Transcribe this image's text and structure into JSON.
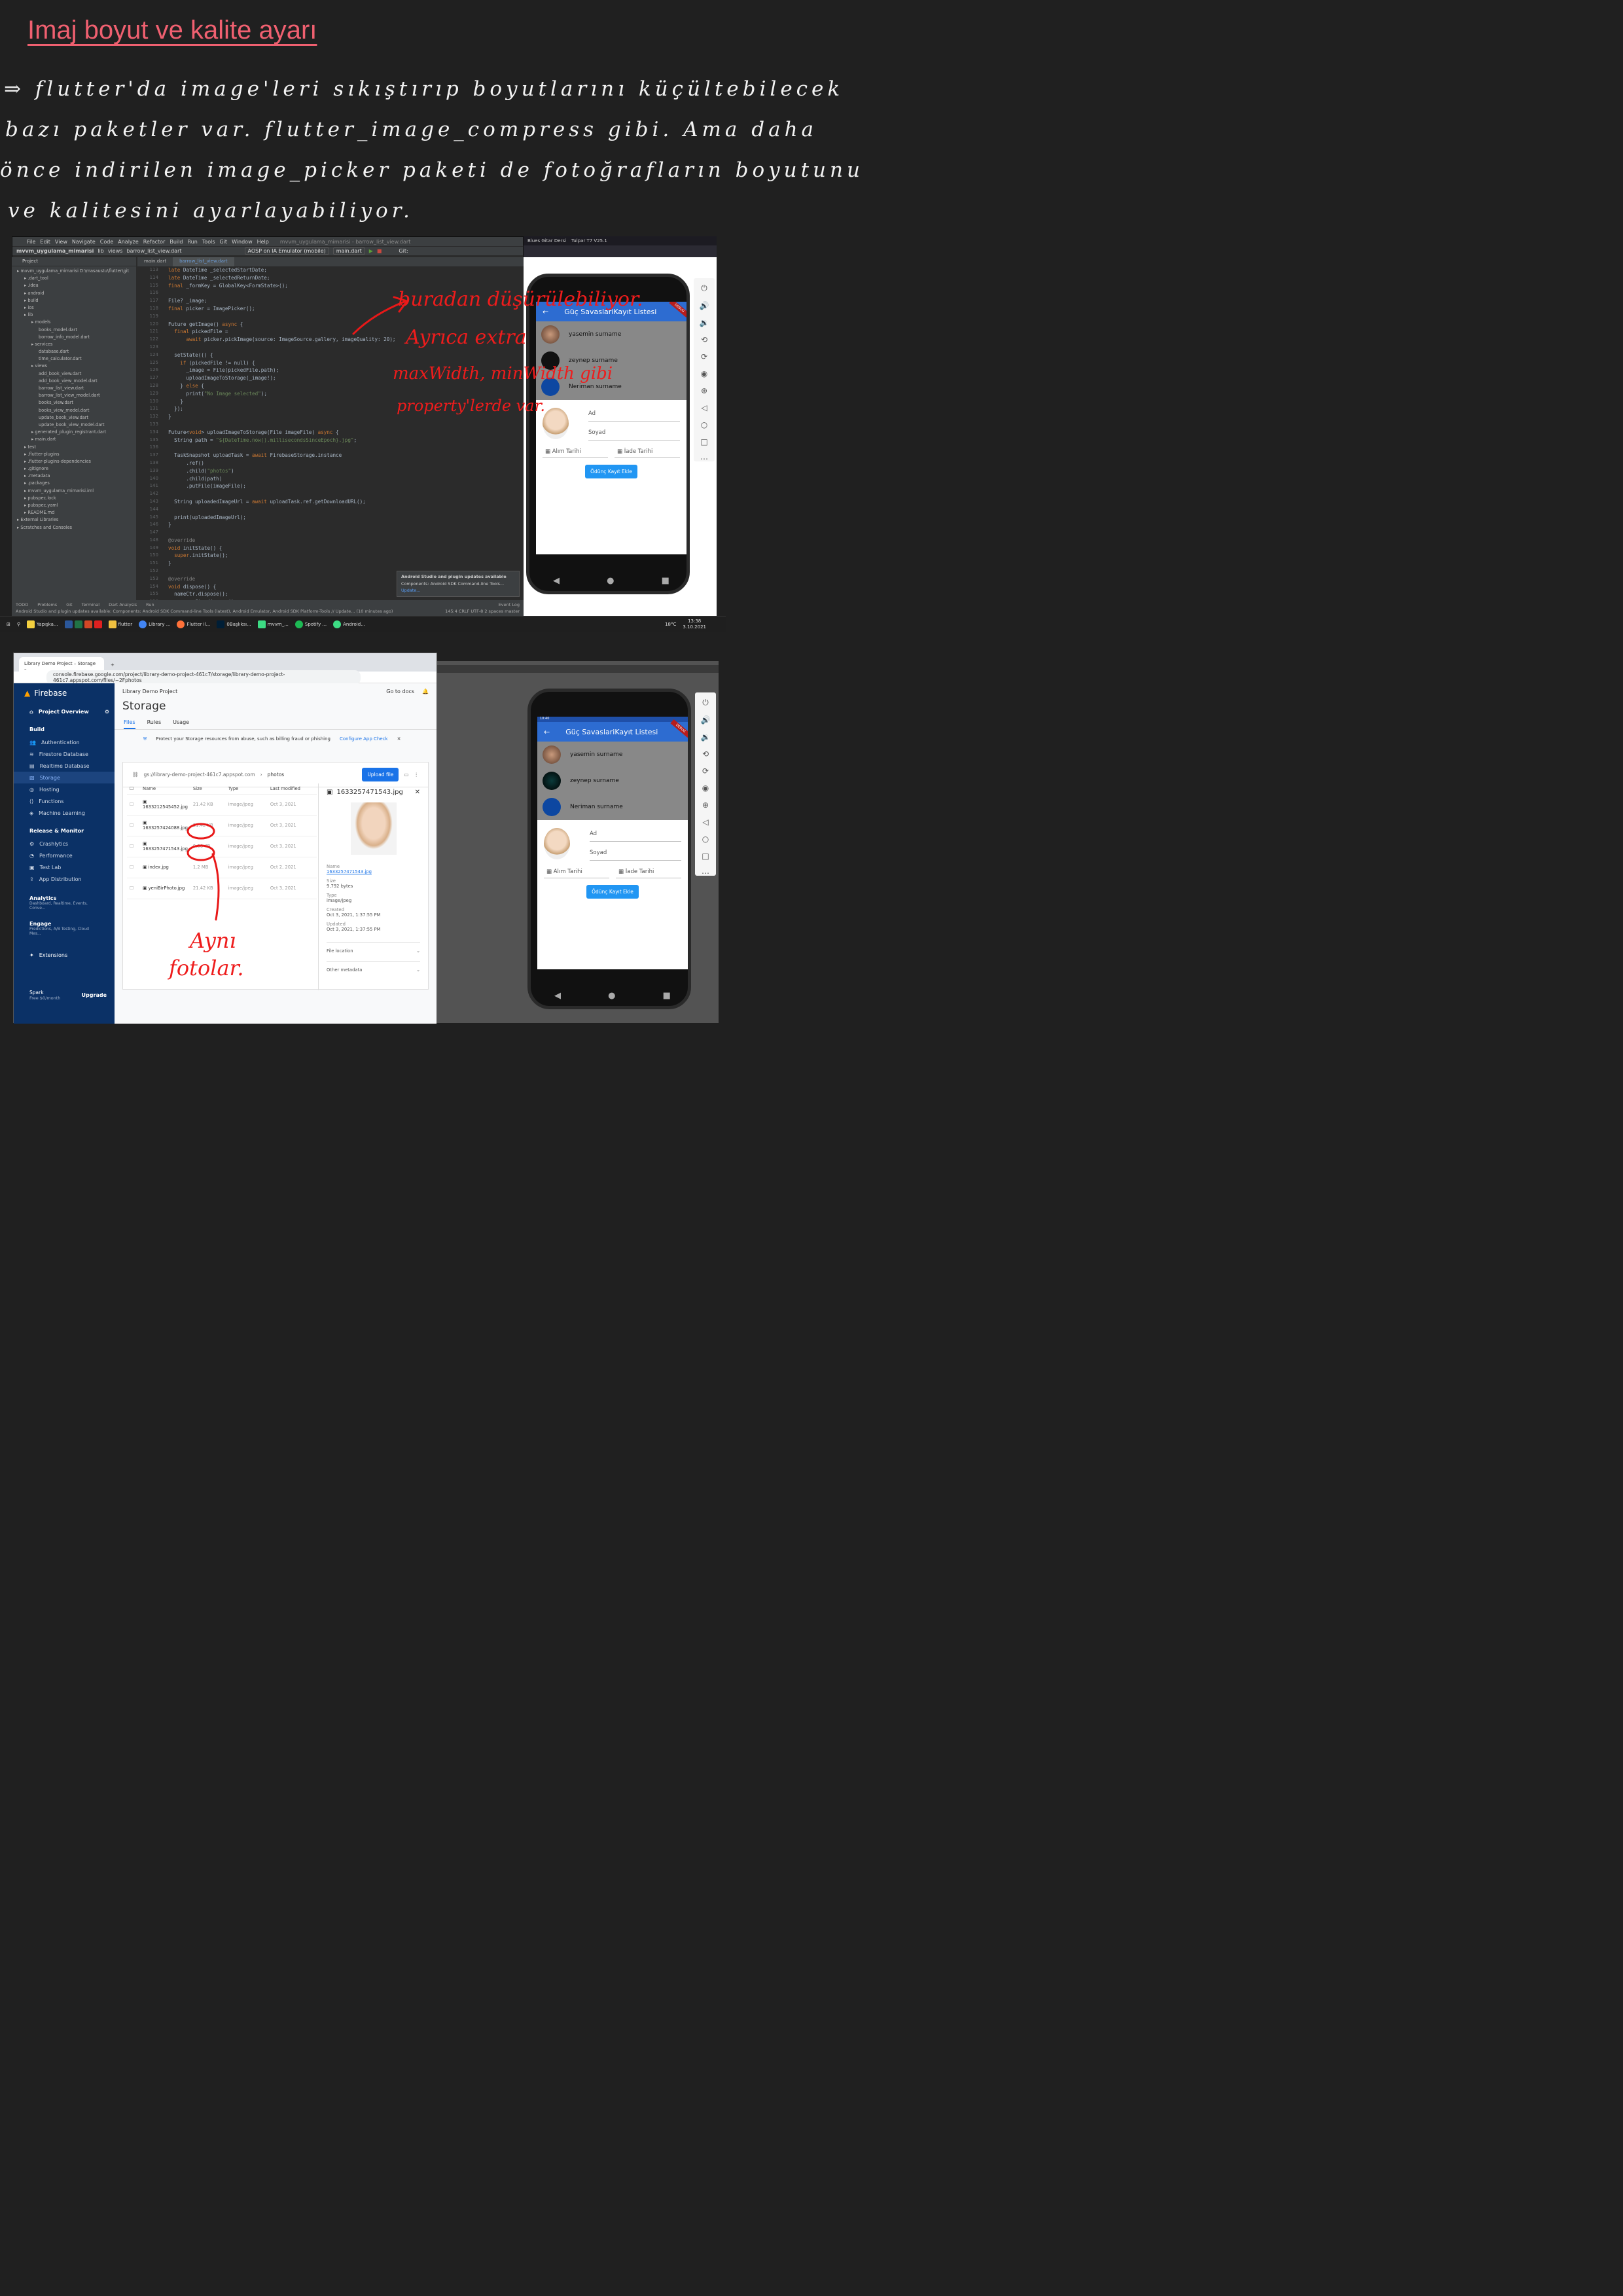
{
  "notes": {
    "title": "Imaj boyut ve kalite ayarı",
    "lines": [
      "⇒ flutter'da  image'leri  sıkıştırıp  boyutlarını  küçültebilecek",
      "bazı  paketler  var.  flutter_image_compress   gibi.  Ama  daha",
      "önce  indirilen  image_picker  paketi  de   fotoğrafların  boyutunu",
      "ve  kalitesini  ayarlayabiliyor."
    ]
  },
  "ide": {
    "menu": [
      "File",
      "Edit",
      "View",
      "Navigate",
      "Code",
      "Analyze",
      "Refactor",
      "Build",
      "Run",
      "Tools",
      "Git",
      "Window",
      "Help"
    ],
    "window_title": "mvvm_uygulama_mimarisi - barrow_list_view.dart",
    "breadcrumb": [
      "mvvm_uygulama_mimarisi",
      "lib",
      "views",
      "barrow_list_view.dart"
    ],
    "device": "AOSP on IA Emulator (mobile)",
    "run_config": "main.dart",
    "git_label": "Git:",
    "tabs": [
      "main.dart",
      "barrow_list_view.dart"
    ],
    "project_label": "Project",
    "tree": [
      {
        "t": "mvvm_uygulama_mimarisi  D:\\masaustu\\flutter\\git",
        "c": "f",
        "d": 0
      },
      {
        "t": ".dart_tool",
        "c": "y",
        "d": 1
      },
      {
        "t": ".idea",
        "c": "f",
        "d": 1
      },
      {
        "t": "android",
        "c": "f",
        "d": 1
      },
      {
        "t": "build",
        "c": "y",
        "d": 1
      },
      {
        "t": "ios",
        "c": "f",
        "d": 1
      },
      {
        "t": "lib",
        "c": "f",
        "d": 1
      },
      {
        "t": "models",
        "c": "f",
        "d": 2
      },
      {
        "t": "books_model.dart",
        "c": "f",
        "d": 3
      },
      {
        "t": "borrow_info_model.dart",
        "c": "f",
        "d": 3
      },
      {
        "t": "services",
        "c": "f",
        "d": 2
      },
      {
        "t": "database.dart",
        "c": "f",
        "d": 3
      },
      {
        "t": "time_calculator.dart",
        "c": "f",
        "d": 3
      },
      {
        "t": "views",
        "c": "f",
        "d": 2
      },
      {
        "t": "add_book_view.dart",
        "c": "f",
        "d": 3
      },
      {
        "t": "add_book_view_model.dart",
        "c": "f",
        "d": 3
      },
      {
        "t": "barrow_list_view.dart",
        "c": "bl",
        "d": 3
      },
      {
        "t": "barrow_list_view_model.dart",
        "c": "f",
        "d": 3
      },
      {
        "t": "books_view.dart",
        "c": "f",
        "d": 3
      },
      {
        "t": "books_view_model.dart",
        "c": "f",
        "d": 3
      },
      {
        "t": "update_book_view.dart",
        "c": "f",
        "d": 3
      },
      {
        "t": "update_book_view_model.dart",
        "c": "f",
        "d": 3
      },
      {
        "t": "generated_plugin_registrant.dart",
        "c": "y",
        "d": 2
      },
      {
        "t": "main.dart",
        "c": "f",
        "d": 2
      },
      {
        "t": "test",
        "c": "f",
        "d": 1
      },
      {
        "t": ".flutter-plugins",
        "c": "y",
        "d": 1
      },
      {
        "t": ".flutter-plugins-dependencies",
        "c": "y",
        "d": 1
      },
      {
        "t": ".gitignore",
        "c": "f",
        "d": 1
      },
      {
        "t": ".metadata",
        "c": "f",
        "d": 1
      },
      {
        "t": ".packages",
        "c": "y",
        "d": 1
      },
      {
        "t": "mvvm_uygulama_mimarisi.iml",
        "c": "y",
        "d": 1
      },
      {
        "t": "pubspec.lock",
        "c": "f",
        "d": 1
      },
      {
        "t": "pubspec.yaml",
        "c": "f",
        "d": 1
      },
      {
        "t": "README.md",
        "c": "f",
        "d": 1
      },
      {
        "t": "External Libraries",
        "c": "f",
        "d": 0
      },
      {
        "t": "Scratches and Consoles",
        "c": "f",
        "d": 0
      }
    ],
    "line_start": 113,
    "code": [
      "late DateTime _selectedStartDate;",
      "late DateTime _selectedReturnDate;",
      "final _formKey = GlobalKey<FormState>();",
      "",
      "File? _image;",
      "final picker = ImagePicker();",
      "",
      "Future getImage() async {",
      "  final pickedFile =",
      "      await picker.pickImage(source: ImageSource.gallery, imageQuality: 20);",
      "",
      "  setState(() {",
      "    if (pickedFile != null) {",
      "      _image = File(pickedFile.path);",
      "      uploadImageToStorage(_image!);",
      "    } else {",
      "      print(\"No Image selected\");",
      "    }",
      "  });",
      "}",
      "",
      "Future<void> uploadImageToStorage(File imageFile) async {",
      "  String path = \"${DateTime.now().millisecondsSinceEpoch}.jpg\";",
      "",
      "  TaskSnapshot uploadTask = await FirebaseStorage.instance",
      "      .ref()",
      "      .child(\"photos\")",
      "      .child(path)",
      "      .putFile(imageFile);",
      "",
      "  String uploadedImageUrl = await uploadTask.ref.getDownloadURL();",
      "",
      "  print(uploadedImageUrl);",
      "}",
      "",
      "@override",
      "void initState() {",
      "  super.initState();",
      "}",
      "",
      "@override",
      "void dispose() {",
      "  nameCtr.dispose();",
      "  surnameCtr.dispose();"
    ],
    "notification": {
      "title": "Android Studio and plugin updates available",
      "body": "Components: Android SDK Command-line Tools...",
      "link": "Update..."
    },
    "bottom_tabs": [
      "TODO",
      "Problems",
      "Git",
      "Terminal",
      "Dart Analysis",
      "Run",
      "Event Log"
    ],
    "status": "Android Studio and plugin updates available: Components: Android SDK Command-line Tools (latest), Android Emulator, Android SDK Platform-Tools // Update... (10 minutes ago)",
    "status_right": "145:4  CRLF  UTF-8  2 spaces  master",
    "annotation": [
      "buradan düşürülebiliyor.",
      "Ayrıca extra",
      "maxWidth, minWidth gibi",
      "property'lerde var."
    ]
  },
  "browser_top": {
    "tabs": [
      "Blues Gitar Dersi",
      "Tulpar T7 V25.1"
    ]
  },
  "taskbar": {
    "items": [
      "Yapışka...",
      "flutter",
      "Library ...",
      "Flutter il...",
      "0Başlıksı...",
      "mvvm_...",
      "Spotify ...",
      "Android..."
    ],
    "temp": "18°C",
    "time": "13:38",
    "date": "3.10.2021"
  },
  "app": {
    "title": "Güç SavaslariKayıt Listesi",
    "people": [
      "yasemin surname",
      "zeynep surname",
      "Neriman  surname"
    ],
    "ad": "Ad",
    "soyad": "Soyad",
    "alim": "Alım Tarihi",
    "iade": "İade Tarihi",
    "button": "Ödünç Kayıt Ekle",
    "debug": "DEBUG"
  },
  "phone2": {
    "time": "10:40"
  },
  "firebase": {
    "tab": "Library Demo Project – Storage –",
    "url": "console.firebase.google.com/project/library-demo-project-461c7/storage/library-demo-project-461c7.appspot.com/files/~2Fphotos",
    "brand": "Firebase",
    "overview": "Project Overview",
    "build": "Build",
    "build_items": [
      "Authentication",
      "Firestore Database",
      "Realtime Database",
      "Storage",
      "Hosting",
      "Functions",
      "Machine Learning"
    ],
    "release": "Release & Monitor",
    "release_items": [
      "Crashlytics",
      "Performance",
      "Test Lab",
      "App Distribution"
    ],
    "analytics": "Analytics",
    "analytics_sub": "Dashboard, Realtime, Events, Conve...",
    "engage": "Engage",
    "engage_sub": "Predictions, A/B Testing, Cloud Mes...",
    "extensions": "Extensions",
    "plan": "Spark",
    "plan_sub": "Free $0/month",
    "upgrade": "Upgrade",
    "project": "Library Demo Project",
    "docs": "Go to docs",
    "page_title": "Storage",
    "tabs": [
      "Files",
      "Rules",
      "Usage"
    ],
    "banner": "Protect your Storage resources from abuse, such as billing fraud or phishing",
    "banner_link": "Configure App Check",
    "bucket": "gs://library-demo-project-461c7.appspot.com",
    "folder": "photos",
    "upload": "Upload file",
    "columns": [
      "Name",
      "Size",
      "Type",
      "Last modified"
    ],
    "rows": [
      [
        "1633212545452.jpg",
        "21.42 KB",
        "image/jpeg",
        "Oct 3, 2021"
      ],
      [
        "1633257424088.jpg",
        "21.42 KB",
        "image/jpeg",
        "Oct 3, 2021"
      ],
      [
        "1633257471543.jpg",
        "9.56 KB",
        "image/jpeg",
        "Oct 3, 2021"
      ],
      [
        "index.jpg",
        "1.2 MB",
        "image/jpeg",
        "Oct 2, 2021"
      ],
      [
        "yeniBirPhoto.jpg",
        "21.42 KB",
        "image/jpeg",
        "Oct 3, 2021"
      ]
    ],
    "detail": {
      "file": "1633257471543.jpg",
      "name_label": "Name",
      "name": "1633257471543.jpg",
      "size_label": "Size",
      "size": "9,792 bytes",
      "type_label": "Type",
      "type": "image/jpeg",
      "created_label": "Created",
      "created": "Oct 3, 2021, 1:37:55 PM",
      "updated_label": "Updated",
      "updated": "Oct 3, 2021, 1:37:55 PM",
      "location": "File location",
      "meta": "Other metadata"
    },
    "annotation": [
      "Aynı",
      "fotolar."
    ]
  },
  "colors": {
    "note_title": "#f06070",
    "annotation": "#e81818",
    "firebase_nav": "#0b3166",
    "app_bar": "#2d6cd1",
    "button": "#2196f3"
  }
}
